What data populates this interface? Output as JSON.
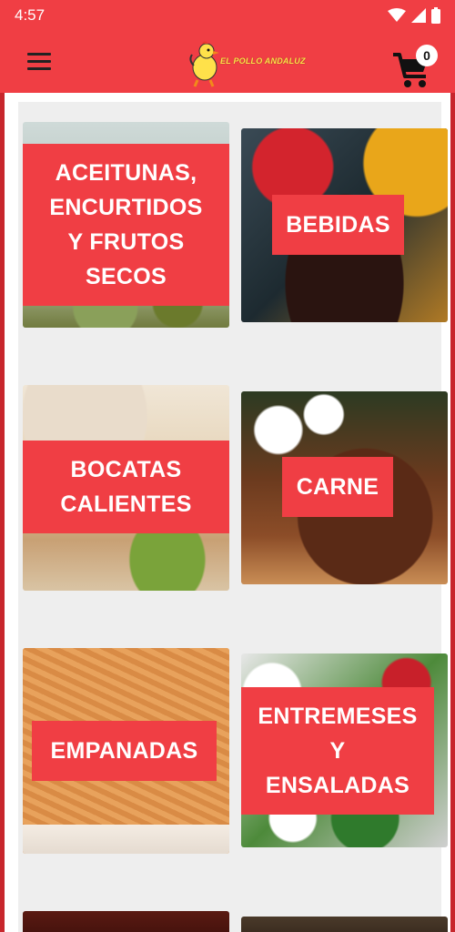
{
  "status_bar": {
    "time": "4:57"
  },
  "app_bar": {
    "logo_text": "EL POLLO ANDALUZ",
    "cart_count": "0"
  },
  "categories": [
    {
      "label": "ACEITUNAS,\nENCURTIDOS\nY FRUTOS\nSECOS"
    },
    {
      "label": "BEBIDAS"
    },
    {
      "label": "BOCATAS\nCALIENTES"
    },
    {
      "label": "CARNE"
    },
    {
      "label": "EMPANADAS"
    },
    {
      "label": "ENTREMESES\nY\nENSALADAS"
    }
  ],
  "colors": {
    "brand_red": "#f03e44",
    "frame_red": "#c7262c",
    "background": "#eeeeee"
  }
}
